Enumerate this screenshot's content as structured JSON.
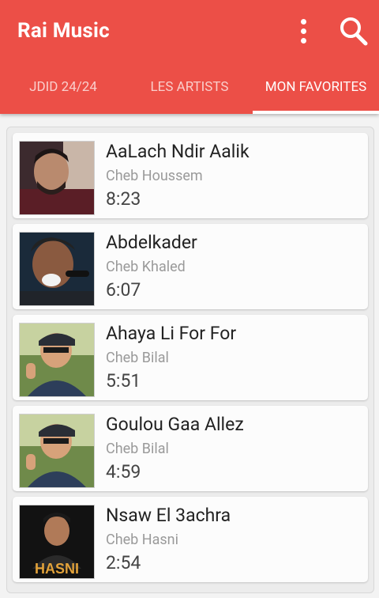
{
  "app": {
    "title": "Rai Music"
  },
  "toolbar": {
    "menu_icon": "more-vert-icon",
    "search_icon": "search-icon"
  },
  "tabs": [
    {
      "label": "JDID 24/24",
      "active": false
    },
    {
      "label": "LES ARTISTS",
      "active": false
    },
    {
      "label": "MON FAVORITES",
      "active": true
    }
  ],
  "favorites": [
    {
      "title": "AaLach Ndir Aalik",
      "artist": "Cheb Houssem",
      "duration": "8:23"
    },
    {
      "title": "Abdelkader",
      "artist": "Cheb Khaled",
      "duration": "6:07"
    },
    {
      "title": "Ahaya Li For For",
      "artist": "Cheb Bilal",
      "duration": "5:51"
    },
    {
      "title": "Goulou Gaa Allez",
      "artist": "Cheb Bilal",
      "duration": "4:59"
    },
    {
      "title": "Nsaw El 3achra",
      "artist": "Cheb Hasni",
      "duration": "2:54",
      "cover_text": "HASNI"
    }
  ],
  "colors": {
    "primary": "#ec4f47",
    "background": "#f3f3f3"
  }
}
